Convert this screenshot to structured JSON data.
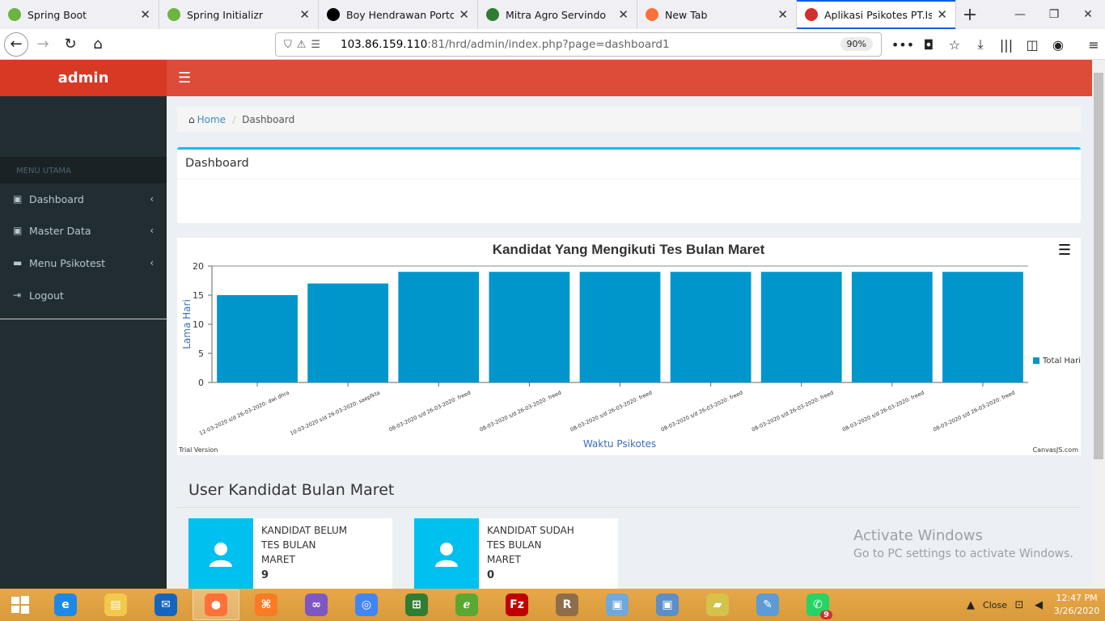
{
  "browser": {
    "tabs": [
      {
        "label": "Spring Boot",
        "icon": "spring-leaf-icon",
        "color": "#6db33f"
      },
      {
        "label": "Spring Initializr",
        "icon": "spring-leaf-icon",
        "color": "#6db33f"
      },
      {
        "label": "Boy Hendrawan Portofolio",
        "icon": "bh-logo-icon",
        "color": "#000000"
      },
      {
        "label": "Mitra Agro Servindo",
        "icon": "triangle-logo-icon",
        "color": "#2e7d32"
      },
      {
        "label": "New Tab",
        "icon": "firefox-icon",
        "color": "#ff7139"
      },
      {
        "label": "Aplikasi Psikotes PT.Island",
        "icon": "app-logo-icon",
        "color": "#d32f2f",
        "active": true
      }
    ],
    "url": {
      "host": "103.86.159.110",
      "path": ":81/hrd/admin/index.php?page=dashboard1"
    },
    "zoom": "90%"
  },
  "app": {
    "brand": "admin",
    "menu_header": "MENU UTAMA",
    "menu": [
      {
        "label": "Dashboard",
        "icon": "dashboard-icon"
      },
      {
        "label": "Master Data",
        "icon": "database-icon"
      },
      {
        "label": "Menu Psikotest",
        "icon": "laptop-icon"
      },
      {
        "label": "Logout",
        "icon": "sign-out-icon"
      }
    ],
    "breadcrumb": {
      "home": "Home",
      "current": "Dashboard"
    },
    "box_title": "Dashboard",
    "section_title": "User Kandidat Bulan Maret",
    "info_boxes": [
      {
        "label": "KANDIDAT BELUM TES BULAN MARET",
        "value": "9"
      },
      {
        "label": "KANDIDAT SUDAH TES BULAN MARET",
        "value": "0"
      }
    ]
  },
  "chart_data": {
    "type": "bar",
    "title": "Kandidat Yang Mengikuti Tes Bulan Maret",
    "xlabel": "Waktu Psikotes",
    "ylabel": "Lama Hari",
    "ylim": [
      0,
      20
    ],
    "yticks": [
      0,
      5,
      10,
      15,
      20
    ],
    "categories": [
      "12-03-2020 s/d 26-03-2020: dwi dhra",
      "10-03-2020 s/d 26-03-2020: saepfkta",
      "08-03-2020 s/d 26-03-2020: freed",
      "08-03-2020 s/d 26-03-2020: freed",
      "08-03-2020 s/d 26-03-2020: freed",
      "08-03-2020 s/d 26-03-2020: freed",
      "08-03-2020 s/d 26-03-2020: freed",
      "08-03-2020 s/d 26-03-2020: freed",
      "08-03-2020 s/d 26-03-2020: freed"
    ],
    "series": [
      {
        "name": "Total Hari",
        "values": [
          15,
          17,
          19,
          19,
          19,
          19,
          19,
          19,
          19
        ],
        "color": "#0096cc"
      }
    ],
    "legend": "right",
    "grid": false,
    "footer_left": "Trial Version",
    "footer_right": "CanvasJS.com"
  },
  "watermark": {
    "line1": "Activate Windows",
    "line2": "Go to PC settings to activate Windows."
  },
  "taskbar": {
    "apps": [
      {
        "name": "internet-explorer-icon",
        "color": "#1e88e5",
        "glyph": "e"
      },
      {
        "name": "file-explorer-icon",
        "color": "#f2c94c",
        "glyph": "▤"
      },
      {
        "name": "thunderbird-icon",
        "color": "#1565c0",
        "glyph": "✉"
      },
      {
        "name": "firefox-icon",
        "color": "#ff7139",
        "glyph": "●",
        "open": true
      },
      {
        "name": "xampp-icon",
        "color": "#fb7a24",
        "glyph": "⌘"
      },
      {
        "name": "visual-studio-icon",
        "color": "#7e57c2",
        "glyph": "∞"
      },
      {
        "name": "chrome-icon",
        "color": "#4285f4",
        "glyph": "◎"
      },
      {
        "name": "store-icon",
        "color": "#2e7d32",
        "glyph": "⊞"
      },
      {
        "name": "eclipse-icon",
        "color": "#5aa832",
        "glyph": "ℯ"
      },
      {
        "name": "filezilla-icon",
        "color": "#bf0000",
        "glyph": "Fz"
      },
      {
        "name": "winrar-icon",
        "color": "#8e6d4a",
        "glyph": "R"
      },
      {
        "name": "virtualbox-icon",
        "color": "#6fa8dc",
        "glyph": "▣"
      },
      {
        "name": "virtualbox2-icon",
        "color": "#5b8fc9",
        "glyph": "▣"
      },
      {
        "name": "sticky-notes-icon",
        "color": "#d4c24a",
        "glyph": "▰"
      },
      {
        "name": "paint-icon",
        "color": "#5c9bd5",
        "glyph": "✎"
      },
      {
        "name": "whatsapp-icon",
        "color": "#25d366",
        "glyph": "✆",
        "badge": "9"
      }
    ],
    "tray_close": "Close",
    "time": "12:47 PM",
    "date": "3/26/2020"
  }
}
